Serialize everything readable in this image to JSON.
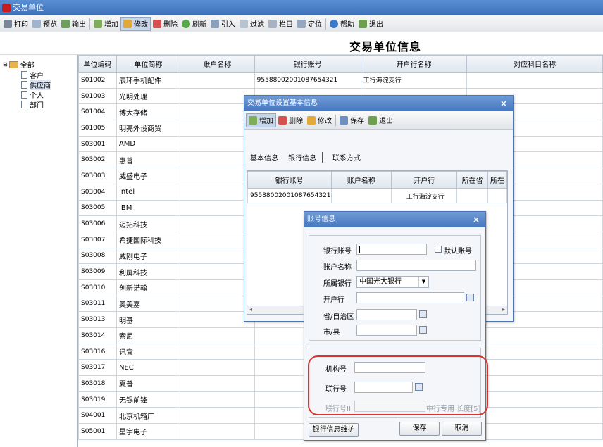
{
  "window": {
    "title": "交易单位"
  },
  "toolbar": {
    "print": "打印",
    "preview": "预览",
    "export": "输出",
    "add": "增加",
    "edit": "修改",
    "delete": "删除",
    "refresh": "刷新",
    "import": "引入",
    "filter": "过滤",
    "columns": "栏目",
    "locate": "定位",
    "help": "帮助",
    "exit": "退出"
  },
  "page": {
    "heading": "交易单位信息"
  },
  "tree": {
    "root": "全部",
    "items": [
      "客户",
      "供应商",
      "个人",
      "部门"
    ]
  },
  "grid": {
    "headers": [
      "单位编码",
      "单位简称",
      "账户名称",
      "银行账号",
      "开户行名称",
      "对应科目名称"
    ],
    "rows": [
      [
        "S01002",
        "辰环手机配件",
        "",
        "9558800200108765432​1",
        "工行海淀支行",
        ""
      ],
      [
        "S01003",
        "光明处理",
        "",
        "",
        "",
        ""
      ],
      [
        "S01004",
        "博大存储",
        "",
        "",
        "",
        ""
      ],
      [
        "S01005",
        "明亮外设商贸",
        "",
        "",
        "",
        ""
      ],
      [
        "S03001",
        "AMD",
        "",
        "",
        "",
        ""
      ],
      [
        "S03002",
        "惠普",
        "",
        "",
        "",
        ""
      ],
      [
        "S03003",
        "威盛电子",
        "",
        "",
        "",
        ""
      ],
      [
        "S03004",
        "Intel",
        "",
        "",
        "",
        ""
      ],
      [
        "S03005",
        "IBM",
        "",
        "",
        "",
        ""
      ],
      [
        "S03006",
        "迈拓科技",
        "",
        "",
        "",
        ""
      ],
      [
        "S03007",
        "希捷国际科技",
        "",
        "",
        "",
        ""
      ],
      [
        "S03008",
        "威刚电子",
        "",
        "",
        "",
        ""
      ],
      [
        "S03009",
        "利屏科技",
        "",
        "",
        "",
        ""
      ],
      [
        "S03010",
        "创新诺翰",
        "",
        "",
        "",
        ""
      ],
      [
        "S03011",
        "奥美嘉",
        "",
        "",
        "",
        ""
      ],
      [
        "S03013",
        "明基",
        "",
        "",
        "",
        ""
      ],
      [
        "S03014",
        "索尼",
        "",
        "",
        "",
        ""
      ],
      [
        "S03016",
        "讯宜",
        "",
        "",
        "",
        ""
      ],
      [
        "S03017",
        "NEC",
        "",
        "",
        "",
        ""
      ],
      [
        "S03018",
        "夏普",
        "",
        "",
        "",
        ""
      ],
      [
        "S03019",
        "无锡前锋",
        "",
        "",
        "",
        ""
      ],
      [
        "S04001",
        "北京机箱厂",
        "",
        "",
        "",
        ""
      ],
      [
        "S05001",
        "星宇电子",
        "",
        "",
        "",
        ""
      ]
    ]
  },
  "dialog_basic": {
    "title": "交易单位设置基本信息",
    "close": "×",
    "toolbar": {
      "add": "增加",
      "delete": "删除",
      "edit": "修改",
      "save": "保存",
      "exit": "退出"
    },
    "tabs": [
      "基本信息",
      "银行信息",
      "联系方式"
    ],
    "table": {
      "headers": [
        "银行账号",
        "账户名称",
        "开户行",
        "所在省",
        "所在"
      ],
      "rows": [
        [
          "95588002001087654321",
          "",
          "工行海淀支行",
          "",
          ""
        ]
      ]
    }
  },
  "dialog_account": {
    "title": "账号信息",
    "close": "×",
    "fields": {
      "bank_account": "银行账号",
      "default_account": "默认账号",
      "account_name": "账户名称",
      "bank": "所属银行",
      "bank_value": "中国光大银行",
      "opening_bank": "开户行",
      "province": "省/自治区",
      "city": "市/县",
      "org_no": "机构号",
      "union_no": "联行号",
      "union_no_2": "联行号II",
      "union_note": "中行专用 长度[5]"
    },
    "buttons": {
      "maintain": "银行信息维护",
      "save": "保存",
      "cancel": "取消"
    }
  },
  "colors": {
    "titlebar": "#4677c0",
    "highlight": "#d9332f"
  }
}
